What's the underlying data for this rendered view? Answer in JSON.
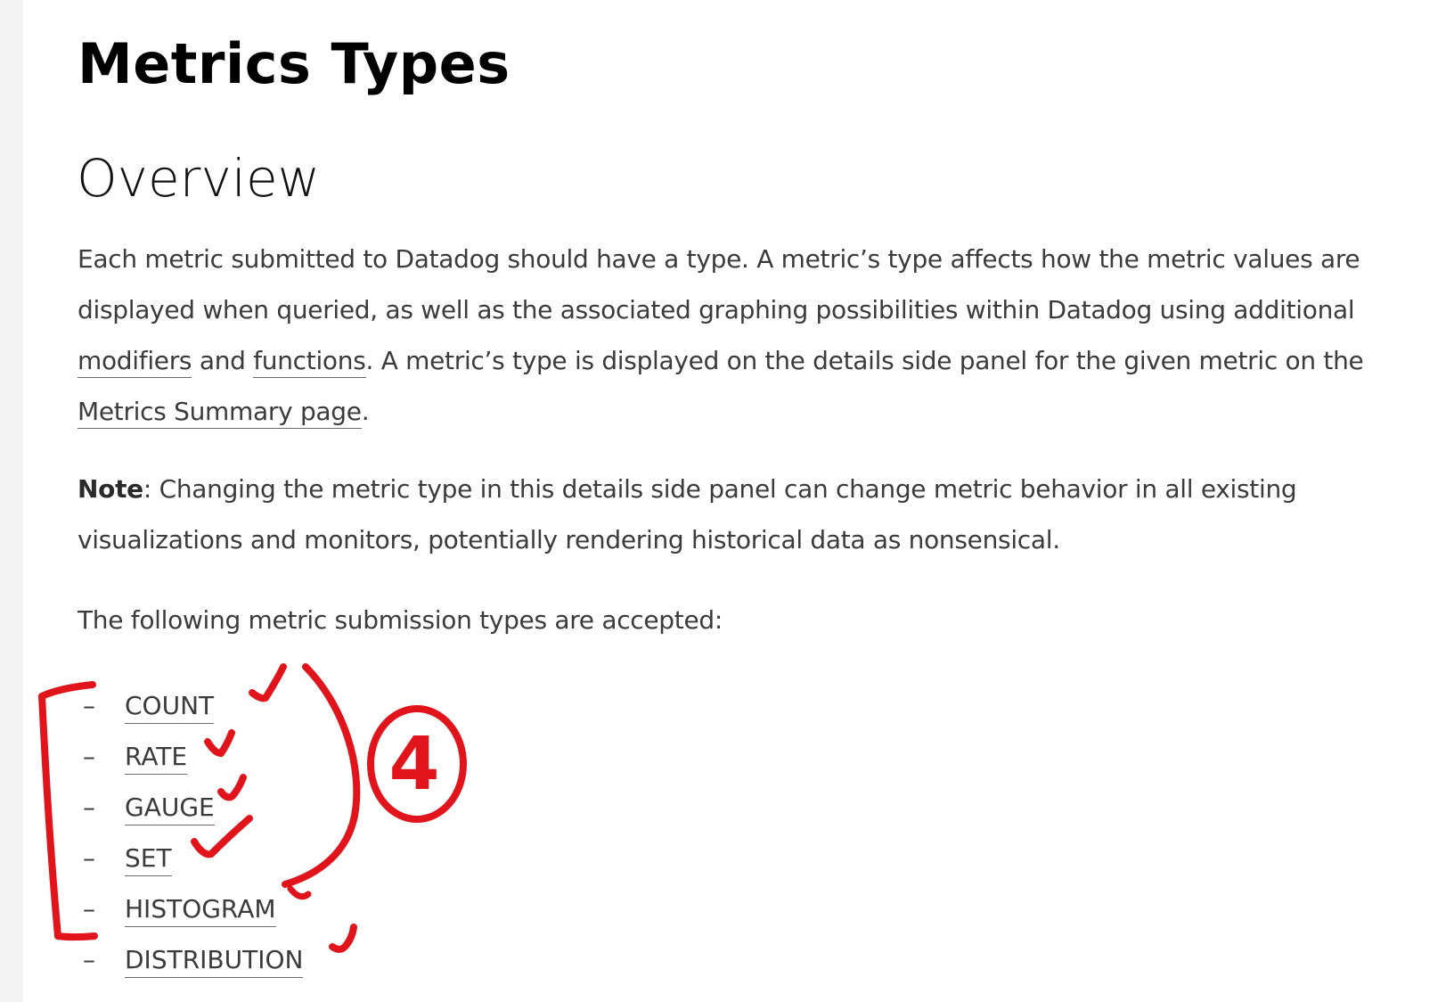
{
  "page": {
    "title": "Metrics Types",
    "section_title": "Overview"
  },
  "intro": {
    "text_before": "Each metric submitted to Datadog should have a type. A metric’s type affects how the metric values are displayed when queried, as well as the associated graphing possibilities within Datadog using additional ",
    "link_modifiers": "modifiers",
    "and": " and ",
    "link_functions": "functions",
    "text_middle": ". A metric’s type is displayed on the details side panel for the given metric on the ",
    "link_summary": "Metrics Summary page",
    "text_end": "."
  },
  "note": {
    "label": "Note",
    "text": ": Changing the metric type in this details side panel can change metric behavior in all existing visualizations and monitors, potentially rendering historical data as nonsensical."
  },
  "types_intro": "The following metric submission types are accepted:",
  "metric_types": [
    {
      "marker": "–",
      "label": "COUNT"
    },
    {
      "marker": "–",
      "label": "RATE"
    },
    {
      "marker": "–",
      "label": "GAUGE"
    },
    {
      "marker": "–",
      "label": "SET"
    },
    {
      "marker": "–",
      "label": "HISTOGRAM"
    },
    {
      "marker": "–",
      "label": "DISTRIBUTION"
    }
  ],
  "annotation": {
    "count_label": "4",
    "ink_color": "#e2141b"
  }
}
